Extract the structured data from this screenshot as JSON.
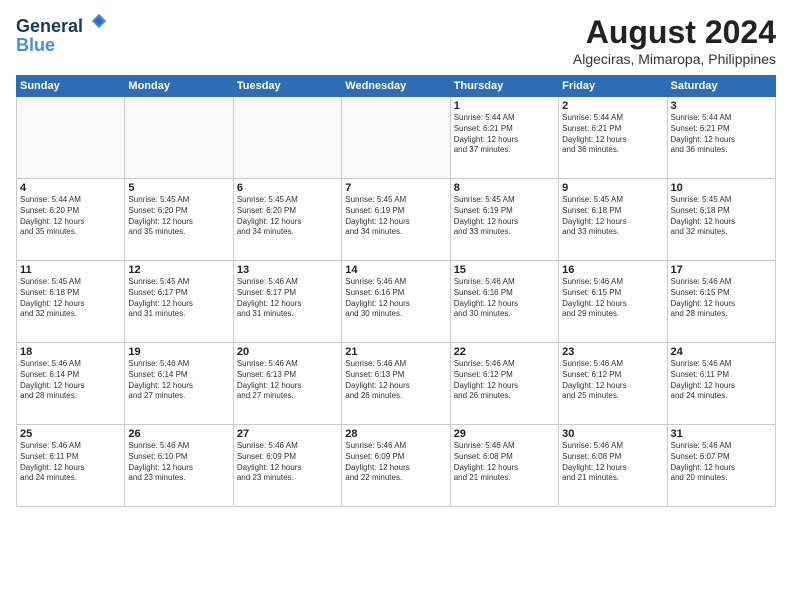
{
  "header": {
    "logo_line1": "General",
    "logo_line2": "Blue",
    "month_year": "August 2024",
    "location": "Algeciras, Mimaropa, Philippines"
  },
  "weekdays": [
    "Sunday",
    "Monday",
    "Tuesday",
    "Wednesday",
    "Thursday",
    "Friday",
    "Saturday"
  ],
  "weeks": [
    [
      {
        "date": "",
        "info": ""
      },
      {
        "date": "",
        "info": ""
      },
      {
        "date": "",
        "info": ""
      },
      {
        "date": "",
        "info": ""
      },
      {
        "date": "1",
        "info": "Sunrise: 5:44 AM\nSunset: 6:21 PM\nDaylight: 12 hours\nand 37 minutes."
      },
      {
        "date": "2",
        "info": "Sunrise: 5:44 AM\nSunset: 6:21 PM\nDaylight: 12 hours\nand 36 minutes."
      },
      {
        "date": "3",
        "info": "Sunrise: 5:44 AM\nSunset: 6:21 PM\nDaylight: 12 hours\nand 36 minutes."
      }
    ],
    [
      {
        "date": "4",
        "info": "Sunrise: 5:44 AM\nSunset: 6:20 PM\nDaylight: 12 hours\nand 35 minutes."
      },
      {
        "date": "5",
        "info": "Sunrise: 5:45 AM\nSunset: 6:20 PM\nDaylight: 12 hours\nand 35 minutes."
      },
      {
        "date": "6",
        "info": "Sunrise: 5:45 AM\nSunset: 6:20 PM\nDaylight: 12 hours\nand 34 minutes."
      },
      {
        "date": "7",
        "info": "Sunrise: 5:45 AM\nSunset: 6:19 PM\nDaylight: 12 hours\nand 34 minutes."
      },
      {
        "date": "8",
        "info": "Sunrise: 5:45 AM\nSunset: 6:19 PM\nDaylight: 12 hours\nand 33 minutes."
      },
      {
        "date": "9",
        "info": "Sunrise: 5:45 AM\nSunset: 6:18 PM\nDaylight: 12 hours\nand 33 minutes."
      },
      {
        "date": "10",
        "info": "Sunrise: 5:45 AM\nSunset: 6:18 PM\nDaylight: 12 hours\nand 32 minutes."
      }
    ],
    [
      {
        "date": "11",
        "info": "Sunrise: 5:45 AM\nSunset: 6:18 PM\nDaylight: 12 hours\nand 32 minutes."
      },
      {
        "date": "12",
        "info": "Sunrise: 5:45 AM\nSunset: 6:17 PM\nDaylight: 12 hours\nand 31 minutes."
      },
      {
        "date": "13",
        "info": "Sunrise: 5:46 AM\nSunset: 6:17 PM\nDaylight: 12 hours\nand 31 minutes."
      },
      {
        "date": "14",
        "info": "Sunrise: 5:46 AM\nSunset: 6:16 PM\nDaylight: 12 hours\nand 30 minutes."
      },
      {
        "date": "15",
        "info": "Sunrise: 5:46 AM\nSunset: 6:16 PM\nDaylight: 12 hours\nand 30 minutes."
      },
      {
        "date": "16",
        "info": "Sunrise: 5:46 AM\nSunset: 6:15 PM\nDaylight: 12 hours\nand 29 minutes."
      },
      {
        "date": "17",
        "info": "Sunrise: 5:46 AM\nSunset: 6:15 PM\nDaylight: 12 hours\nand 28 minutes."
      }
    ],
    [
      {
        "date": "18",
        "info": "Sunrise: 5:46 AM\nSunset: 6:14 PM\nDaylight: 12 hours\nand 28 minutes."
      },
      {
        "date": "19",
        "info": "Sunrise: 5:46 AM\nSunset: 6:14 PM\nDaylight: 12 hours\nand 27 minutes."
      },
      {
        "date": "20",
        "info": "Sunrise: 5:46 AM\nSunset: 6:13 PM\nDaylight: 12 hours\nand 27 minutes."
      },
      {
        "date": "21",
        "info": "Sunrise: 5:46 AM\nSunset: 6:13 PM\nDaylight: 12 hours\nand 26 minutes."
      },
      {
        "date": "22",
        "info": "Sunrise: 5:46 AM\nSunset: 6:12 PM\nDaylight: 12 hours\nand 26 minutes."
      },
      {
        "date": "23",
        "info": "Sunrise: 5:46 AM\nSunset: 6:12 PM\nDaylight: 12 hours\nand 25 minutes."
      },
      {
        "date": "24",
        "info": "Sunrise: 5:46 AM\nSunset: 6:11 PM\nDaylight: 12 hours\nand 24 minutes."
      }
    ],
    [
      {
        "date": "25",
        "info": "Sunrise: 5:46 AM\nSunset: 6:11 PM\nDaylight: 12 hours\nand 24 minutes."
      },
      {
        "date": "26",
        "info": "Sunrise: 5:46 AM\nSunset: 6:10 PM\nDaylight: 12 hours\nand 23 minutes."
      },
      {
        "date": "27",
        "info": "Sunrise: 5:46 AM\nSunset: 6:09 PM\nDaylight: 12 hours\nand 23 minutes."
      },
      {
        "date": "28",
        "info": "Sunrise: 5:46 AM\nSunset: 6:09 PM\nDaylight: 12 hours\nand 22 minutes."
      },
      {
        "date": "29",
        "info": "Sunrise: 5:46 AM\nSunset: 6:08 PM\nDaylight: 12 hours\nand 21 minutes."
      },
      {
        "date": "30",
        "info": "Sunrise: 5:46 AM\nSunset: 6:08 PM\nDaylight: 12 hours\nand 21 minutes."
      },
      {
        "date": "31",
        "info": "Sunrise: 5:46 AM\nSunset: 6:07 PM\nDaylight: 12 hours\nand 20 minutes."
      }
    ]
  ]
}
